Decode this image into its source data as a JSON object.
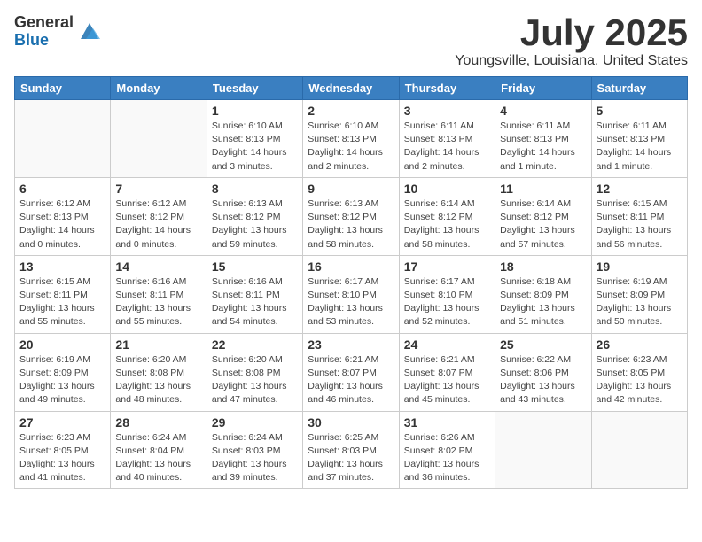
{
  "logo": {
    "general": "General",
    "blue": "Blue"
  },
  "title": "July 2025",
  "location": "Youngsville, Louisiana, United States",
  "days_of_week": [
    "Sunday",
    "Monday",
    "Tuesday",
    "Wednesday",
    "Thursday",
    "Friday",
    "Saturday"
  ],
  "weeks": [
    [
      {
        "day": "",
        "info": ""
      },
      {
        "day": "",
        "info": ""
      },
      {
        "day": "1",
        "info": "Sunrise: 6:10 AM\nSunset: 8:13 PM\nDaylight: 14 hours\nand 3 minutes."
      },
      {
        "day": "2",
        "info": "Sunrise: 6:10 AM\nSunset: 8:13 PM\nDaylight: 14 hours\nand 2 minutes."
      },
      {
        "day": "3",
        "info": "Sunrise: 6:11 AM\nSunset: 8:13 PM\nDaylight: 14 hours\nand 2 minutes."
      },
      {
        "day": "4",
        "info": "Sunrise: 6:11 AM\nSunset: 8:13 PM\nDaylight: 14 hours\nand 1 minute."
      },
      {
        "day": "5",
        "info": "Sunrise: 6:11 AM\nSunset: 8:13 PM\nDaylight: 14 hours\nand 1 minute."
      }
    ],
    [
      {
        "day": "6",
        "info": "Sunrise: 6:12 AM\nSunset: 8:13 PM\nDaylight: 14 hours\nand 0 minutes."
      },
      {
        "day": "7",
        "info": "Sunrise: 6:12 AM\nSunset: 8:12 PM\nDaylight: 14 hours\nand 0 minutes."
      },
      {
        "day": "8",
        "info": "Sunrise: 6:13 AM\nSunset: 8:12 PM\nDaylight: 13 hours\nand 59 minutes."
      },
      {
        "day": "9",
        "info": "Sunrise: 6:13 AM\nSunset: 8:12 PM\nDaylight: 13 hours\nand 58 minutes."
      },
      {
        "day": "10",
        "info": "Sunrise: 6:14 AM\nSunset: 8:12 PM\nDaylight: 13 hours\nand 58 minutes."
      },
      {
        "day": "11",
        "info": "Sunrise: 6:14 AM\nSunset: 8:12 PM\nDaylight: 13 hours\nand 57 minutes."
      },
      {
        "day": "12",
        "info": "Sunrise: 6:15 AM\nSunset: 8:11 PM\nDaylight: 13 hours\nand 56 minutes."
      }
    ],
    [
      {
        "day": "13",
        "info": "Sunrise: 6:15 AM\nSunset: 8:11 PM\nDaylight: 13 hours\nand 55 minutes."
      },
      {
        "day": "14",
        "info": "Sunrise: 6:16 AM\nSunset: 8:11 PM\nDaylight: 13 hours\nand 55 minutes."
      },
      {
        "day": "15",
        "info": "Sunrise: 6:16 AM\nSunset: 8:11 PM\nDaylight: 13 hours\nand 54 minutes."
      },
      {
        "day": "16",
        "info": "Sunrise: 6:17 AM\nSunset: 8:10 PM\nDaylight: 13 hours\nand 53 minutes."
      },
      {
        "day": "17",
        "info": "Sunrise: 6:17 AM\nSunset: 8:10 PM\nDaylight: 13 hours\nand 52 minutes."
      },
      {
        "day": "18",
        "info": "Sunrise: 6:18 AM\nSunset: 8:09 PM\nDaylight: 13 hours\nand 51 minutes."
      },
      {
        "day": "19",
        "info": "Sunrise: 6:19 AM\nSunset: 8:09 PM\nDaylight: 13 hours\nand 50 minutes."
      }
    ],
    [
      {
        "day": "20",
        "info": "Sunrise: 6:19 AM\nSunset: 8:09 PM\nDaylight: 13 hours\nand 49 minutes."
      },
      {
        "day": "21",
        "info": "Sunrise: 6:20 AM\nSunset: 8:08 PM\nDaylight: 13 hours\nand 48 minutes."
      },
      {
        "day": "22",
        "info": "Sunrise: 6:20 AM\nSunset: 8:08 PM\nDaylight: 13 hours\nand 47 minutes."
      },
      {
        "day": "23",
        "info": "Sunrise: 6:21 AM\nSunset: 8:07 PM\nDaylight: 13 hours\nand 46 minutes."
      },
      {
        "day": "24",
        "info": "Sunrise: 6:21 AM\nSunset: 8:07 PM\nDaylight: 13 hours\nand 45 minutes."
      },
      {
        "day": "25",
        "info": "Sunrise: 6:22 AM\nSunset: 8:06 PM\nDaylight: 13 hours\nand 43 minutes."
      },
      {
        "day": "26",
        "info": "Sunrise: 6:23 AM\nSunset: 8:05 PM\nDaylight: 13 hours\nand 42 minutes."
      }
    ],
    [
      {
        "day": "27",
        "info": "Sunrise: 6:23 AM\nSunset: 8:05 PM\nDaylight: 13 hours\nand 41 minutes."
      },
      {
        "day": "28",
        "info": "Sunrise: 6:24 AM\nSunset: 8:04 PM\nDaylight: 13 hours\nand 40 minutes."
      },
      {
        "day": "29",
        "info": "Sunrise: 6:24 AM\nSunset: 8:03 PM\nDaylight: 13 hours\nand 39 minutes."
      },
      {
        "day": "30",
        "info": "Sunrise: 6:25 AM\nSunset: 8:03 PM\nDaylight: 13 hours\nand 37 minutes."
      },
      {
        "day": "31",
        "info": "Sunrise: 6:26 AM\nSunset: 8:02 PM\nDaylight: 13 hours\nand 36 minutes."
      },
      {
        "day": "",
        "info": ""
      },
      {
        "day": "",
        "info": ""
      }
    ]
  ]
}
